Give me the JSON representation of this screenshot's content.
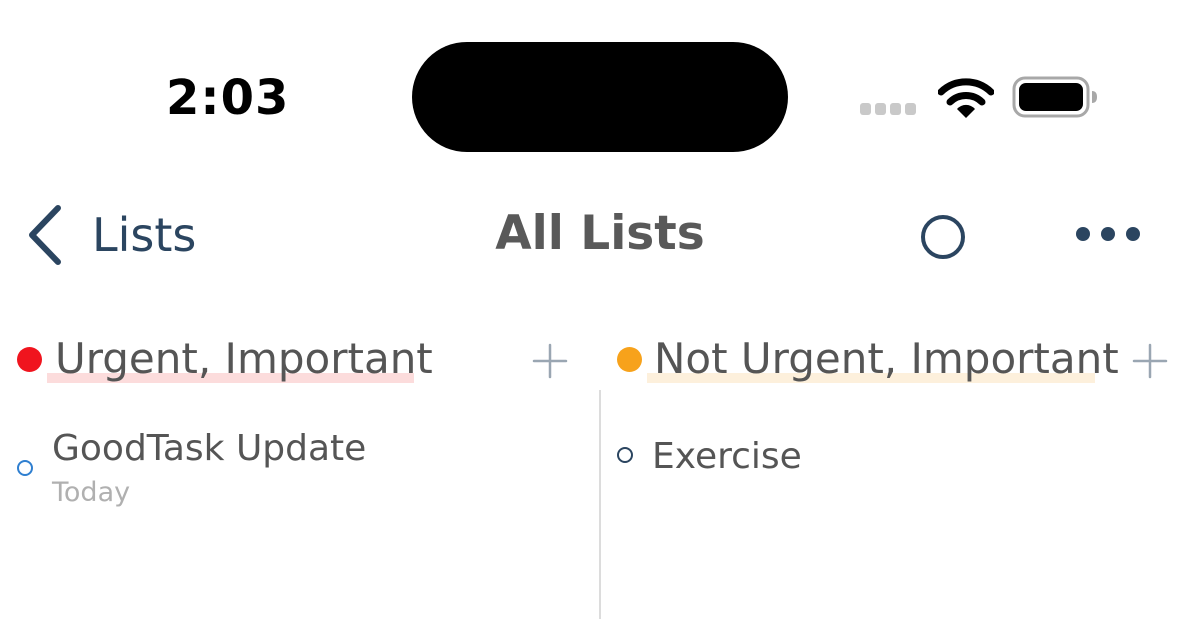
{
  "status_bar": {
    "time": "2:03"
  },
  "nav": {
    "back_label": "Lists",
    "title": "All Lists",
    "accent_color": "#2b4560"
  },
  "columns": [
    {
      "title": "Urgent, Important",
      "dot_color": "#f0141e",
      "underline_color": "#fcdcdc",
      "tasks": [
        {
          "title": "GoodTask Update",
          "due": "Today",
          "check_color": "#2f7fd0"
        }
      ]
    },
    {
      "title": "Not Urgent, Important",
      "dot_color": "#f7a21b",
      "underline_color": "#fdf0dc",
      "tasks": [
        {
          "title": "Exercise",
          "check_color": "#2b4560"
        }
      ]
    }
  ],
  "icons": {
    "back": "chevron-left-icon",
    "circle": "circle-outline-icon",
    "more": "ellipsis-icon",
    "add": "plus-icon",
    "wifi": "wifi-icon",
    "battery": "battery-icon",
    "signal": "cellular-signal-icon"
  }
}
